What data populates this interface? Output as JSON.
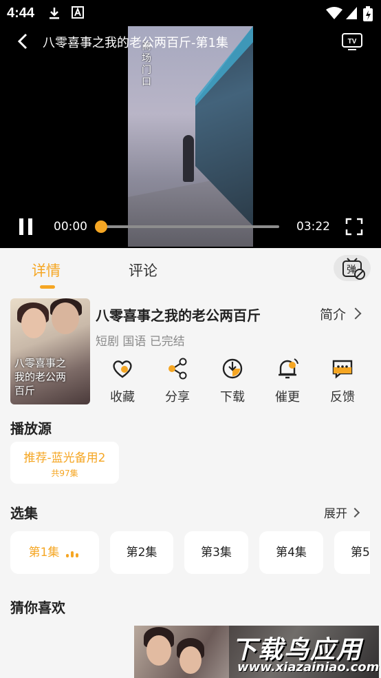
{
  "status_bar": {
    "time": "4:44"
  },
  "player": {
    "title": "八零喜事之我的老公两百斤-第1集",
    "video_overlay_text": "商场门口",
    "current_time": "00:00",
    "total_time": "03:22",
    "progress": 0
  },
  "tabs": [
    {
      "label": "详情",
      "active": true
    },
    {
      "label": "评论",
      "active": false
    }
  ],
  "danmaku_icon_label": "弹",
  "drama": {
    "poster_title": "八零喜事之我的老公两百斤",
    "title": "八零喜事之我的老公两百斤",
    "intro_label": "简介",
    "meta": "短剧 国语 已完结",
    "actions": [
      {
        "label": "收藏",
        "icon": "heart-icon"
      },
      {
        "label": "分享",
        "icon": "share-icon"
      },
      {
        "label": "下载",
        "icon": "download-icon"
      },
      {
        "label": "催更",
        "icon": "bell-icon"
      },
      {
        "label": "反馈",
        "icon": "feedback-icon"
      }
    ]
  },
  "play_source": {
    "section_title": "播放源",
    "name": "推荐-蓝光备用2",
    "count": "共97集"
  },
  "episodes": {
    "section_title": "选集",
    "expand_label": "展开",
    "items": [
      "第1集",
      "第2集",
      "第3集",
      "第4集",
      "第5"
    ],
    "active_index": 0
  },
  "recommend": {
    "section_title": "猜你喜欢"
  },
  "watermark": {
    "line1": "下载鸟应用",
    "line2": "www.xiazainiao.com"
  },
  "colors": {
    "accent": "#f5a623",
    "background": "#f5f5f5",
    "text": "#222222"
  }
}
